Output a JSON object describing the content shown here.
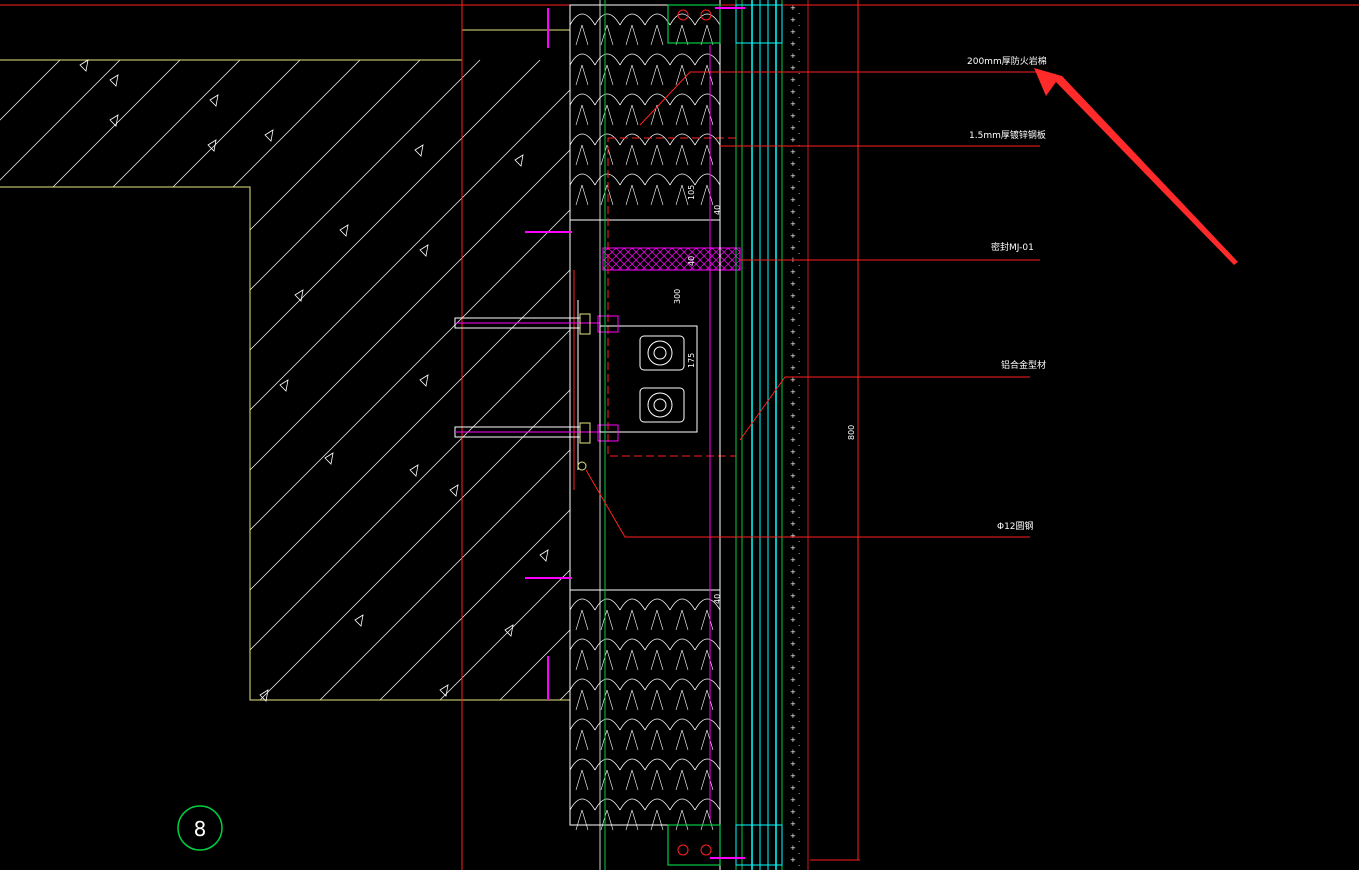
{
  "drawing": {
    "detail_number": "8",
    "colors": {
      "background": "#000000",
      "structure": "#e6e680",
      "hatch": "#ffffff",
      "gridline": "#ff2020",
      "steel": "#ff00ff",
      "glass": "#00ffff",
      "frame": "#00cc44",
      "arrow": "#ff2a2a"
    },
    "callouts": [
      {
        "id": "c1",
        "text": "200mm厚防火岩棉"
      },
      {
        "id": "c2",
        "text": "1.5mm厚镀锌钢板"
      },
      {
        "id": "c3",
        "text": "密封MJ-01"
      },
      {
        "id": "c4",
        "text": "铝合金型材"
      },
      {
        "id": "c5",
        "text": "Φ12圆钢"
      }
    ],
    "dimensions": {
      "d105": "105",
      "d40a": "40",
      "d40b": "40",
      "d300": "300",
      "d175": "175",
      "d40c": "40",
      "d800": "800"
    }
  }
}
